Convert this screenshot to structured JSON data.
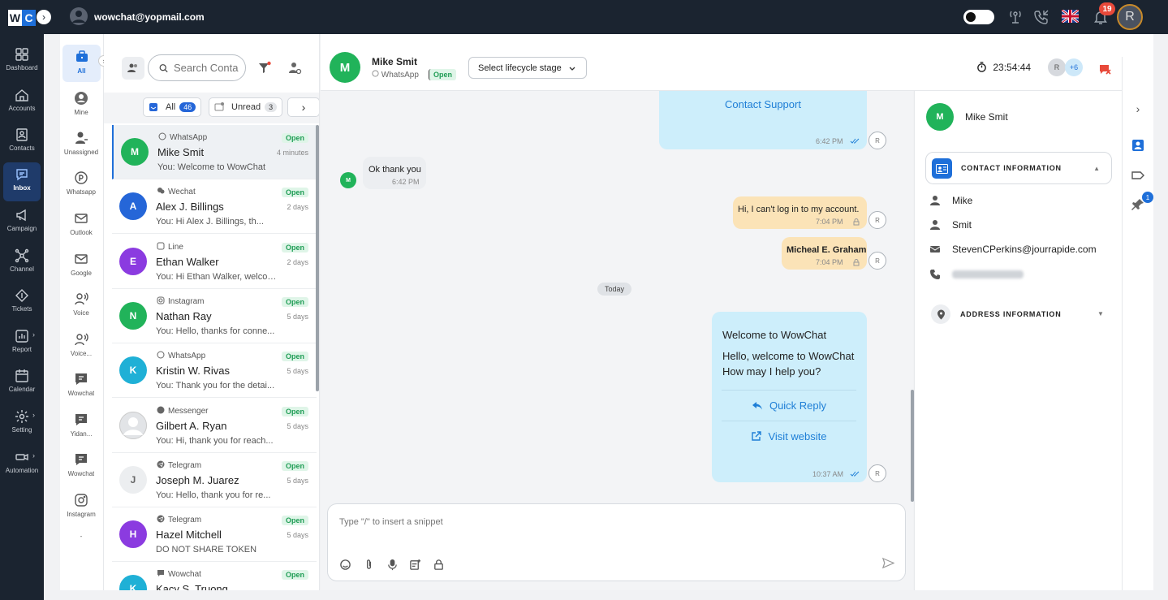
{
  "topbar": {
    "logo_w": "W",
    "logo_c": "C",
    "user_email": "wowchat@yopmail.com",
    "notif_count": "19",
    "avatar_letter": "R"
  },
  "leftnav": [
    {
      "label": "Dashboard",
      "icon": "dashboard-icon"
    },
    {
      "label": "Accounts",
      "icon": "home-icon"
    },
    {
      "label": "Contacts",
      "icon": "contacts-icon"
    },
    {
      "label": "Inbox",
      "icon": "inbox-icon",
      "active": true
    },
    {
      "label": "Campaign",
      "icon": "megaphone-icon"
    },
    {
      "label": "Channel",
      "icon": "channel-icon"
    },
    {
      "label": "Tickets",
      "icon": "ticket-icon"
    },
    {
      "label": "Report",
      "icon": "report-icon"
    },
    {
      "label": "Calendar",
      "icon": "calendar-icon"
    },
    {
      "label": "Setting",
      "icon": "gear-icon"
    },
    {
      "label": "Automation",
      "icon": "automation-icon"
    }
  ],
  "channels": [
    {
      "label": "All",
      "icon": "briefcase-icon"
    },
    {
      "label": "Mine",
      "icon": "user-circle-icon"
    },
    {
      "label": "Unassigned",
      "icon": "user-unassigned-icon"
    },
    {
      "label": "Whatsapp",
      "icon": "whatsapp-icon"
    },
    {
      "label": "Outlook",
      "icon": "mail-icon"
    },
    {
      "label": "Google",
      "icon": "mail-icon"
    },
    {
      "label": "Voice",
      "icon": "voice-icon"
    },
    {
      "label": "Voice...",
      "icon": "voice-icon"
    },
    {
      "label": "Wowchat",
      "icon": "chat-icon"
    },
    {
      "label": "Yidan...",
      "icon": "chat-icon"
    },
    {
      "label": "Wowchat",
      "icon": "chat-icon"
    },
    {
      "label": "Instagram",
      "icon": "instagram-icon"
    },
    {
      "label": "-",
      "icon": ""
    }
  ],
  "conv_toolbar": {
    "search_placeholder": "Search Conta"
  },
  "filter_tabs": {
    "all_label": "All",
    "all_count": "46",
    "unread_label": "Unread",
    "unread_count": "3"
  },
  "conversations": [
    {
      "initial": "M",
      "color": "#21b35a",
      "channel": "WhatsApp",
      "name": "Mike Smit",
      "preview": "You: Welcome to WowChat",
      "status": "Open",
      "time": "4 minutes",
      "selected": true
    },
    {
      "initial": "A",
      "color": "#2566d8",
      "channel": "Wechat",
      "name": "Alex J. Billings",
      "preview": "You: Hi Alex J. Billings, th...",
      "status": "Open",
      "time": "2 days"
    },
    {
      "initial": "E",
      "color": "#8b3be0",
      "channel": "Line",
      "name": "Ethan Walker",
      "preview": "You: Hi Ethan Walker, welcom...",
      "status": "Open",
      "time": "2 days"
    },
    {
      "initial": "N",
      "color": "#21b35a",
      "channel": "Instagram",
      "name": "Nathan Ray",
      "preview": "You: Hello, thanks for conne...",
      "status": "Open",
      "time": "5 days"
    },
    {
      "initial": "K",
      "color": "#1fb0d6",
      "channel": "WhatsApp",
      "name": "Kristin W. Rivas",
      "preview": "You: Thank you for the detai...",
      "status": "Open",
      "time": "5 days"
    },
    {
      "initial": "",
      "color": "#d8dadd",
      "channel": "Messenger",
      "name": "Gilbert A. Ryan",
      "preview": "You: Hi, thank you for reach...",
      "status": "Open",
      "time": "5 days"
    },
    {
      "initial": "J",
      "color": "#eceef0",
      "channel": "Telegram",
      "name": "Joseph M. Juarez",
      "preview": "You: Hello, thank you for re...",
      "status": "Open",
      "time": "5 days"
    },
    {
      "initial": "H",
      "color": "#8b3be0",
      "channel": "Telegram",
      "name": "Hazel Mitchell",
      "preview": "DO NOT SHARE TOKEN",
      "status": "Open",
      "time": "5 days"
    },
    {
      "initial": "K",
      "color": "#1fb0d6",
      "channel": "Wowchat",
      "name": "Kacy S. Truong",
      "preview": "",
      "status": "Open",
      "time": ""
    }
  ],
  "chat_header": {
    "initial": "M",
    "name": "Mike Smit",
    "channel": "WhatsApp",
    "status": "Open",
    "lifecycle": "Select lifecycle stage",
    "timer": "23:54:44",
    "agent_initial": "R",
    "more_agents": "+6"
  },
  "messages": {
    "contact_support": "Contact Support",
    "t1": "6:42 PM",
    "ok_text": "Ok thank you",
    "ok_time": "6:42 PM",
    "ok_avatar": "M",
    "login_text": "Hi, I can't log in to my account.",
    "login_time": "7:04 PM",
    "micheal": "Micheal E. Graham",
    "micheal_time": "7:04 PM",
    "today": "Today",
    "welcome_title": "Welcome to WowChat",
    "welcome_line1": "Hello, welcome to WowChat",
    "welcome_line2": "How may I help you?",
    "quick_reply": "Quick Reply",
    "visit_website": "Visit website",
    "welcome_time": "10:37 AM",
    "r": "R"
  },
  "composer": {
    "placeholder": "Type \"/\" to insert a snippet"
  },
  "contact_panel": {
    "initial": "M",
    "name": "Mike Smit",
    "contact_info_label": "CONTACT INFORMATION",
    "first_name": "Mike",
    "last_name": "Smit",
    "email": "StevenCPerkins@jourrapide.com",
    "address_label": "ADDRESS INFORMATION"
  },
  "rightrail": {
    "badge": "1"
  },
  "colors": {
    "brand": "#1e6fd9",
    "topbar": "#1b2430",
    "open_green": "#1f9d55",
    "bubble_out": "#cdeefb",
    "bubble_warn": "#fbe3b7"
  }
}
